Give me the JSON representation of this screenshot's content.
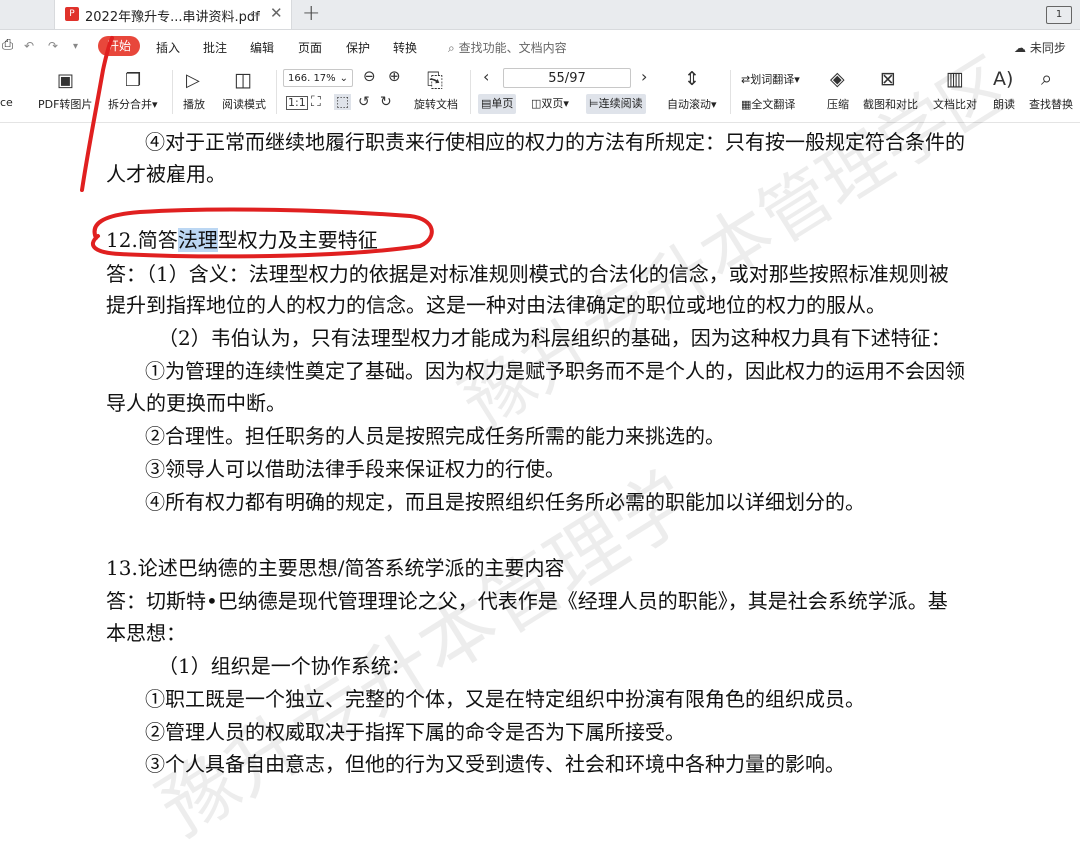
{
  "tab": {
    "title": "2022年豫升专...串讲资料.pdf",
    "pdf_badge": "P",
    "page_indicator": "1"
  },
  "menu": {
    "items": [
      "开始",
      "插入",
      "批注",
      "编辑",
      "页面",
      "保护",
      "转换"
    ],
    "search_placeholder": "查找功能、文档内容",
    "sync_label": "未同步"
  },
  "toolbar": {
    "left_cut": "ce",
    "pdf_to_image": "PDF转图片",
    "split_merge": "拆分合并",
    "play": "播放",
    "read_mode": "阅读模式",
    "zoom_value": "166. 17%",
    "rotate_doc": "旋转文档",
    "page_value": "55/97",
    "single_page": "单页",
    "double_page": "双页",
    "continuous": "连续阅读",
    "auto_scroll": "自动滚动",
    "word_translate": "划词翻译",
    "full_translate": "全文翻译",
    "compress": "压缩",
    "screenshot_compare": "截图和对比",
    "doc_compare": "文档比对",
    "read_aloud": "朗读",
    "find_replace": "查找替换"
  },
  "document": {
    "line_01": "④对于正常而继续地履行职责来行使相应的权力的方法有所规定：只有按一般规定符合条件的",
    "line_02": "人才被雇用。",
    "heading_12_a": "12.简答",
    "heading_12_hl": "法理",
    "heading_12_b": "型权力及主要特征",
    "line_03": "答：（1）含义：法理型权力的依据是对标准规则模式的合法化的信念，或对那些按照标准规则被",
    "line_04": "提升到指挥地位的人的权力的信念。这是一种对由法律确定的职位或地位的权力的服从。",
    "line_05": "（2）韦伯认为，只有法理型权力才能成为科层组织的基础，因为这种权力具有下述特征：",
    "line_06": "①为管理的连续性奠定了基础。因为权力是赋予职务而不是个人的，因此权力的运用不会因领",
    "line_07": "导人的更换而中断。",
    "line_08": "②合理性。担任职务的人员是按照完成任务所需的能力来挑选的。",
    "line_09": "③领导人可以借助法律手段来保证权力的行使。",
    "line_10": "④所有权力都有明确的规定，而且是按照组织任务所必需的职能加以详细划分的。",
    "heading_13": "13.论述巴纳德的主要思想/简答系统学派的主要内容",
    "line_11": "答：切斯特•巴纳德是现代管理理论之父，代表作是《经理人员的职能》，其是社会系统学派。基",
    "line_12": "本思想：",
    "line_13": "（1）组织是一个协作系统：",
    "line_14": "①职工既是一个独立、完整的个体，又是在特定组织中扮演有限角色的组织成员。",
    "line_15": "②管理人员的权威取决于指挥下属的命令是否为下属所接受。",
    "line_16": "③个人具备自由意志，但他的行为又受到遗传、社会和环境中各种力量的影响。"
  },
  "watermark": {
    "text_a": "豫升专升本管理学",
    "text_b": "豫升专升本管理学区"
  },
  "colors": {
    "accent_red": "#e8473b",
    "annotation_red": "#e02020",
    "highlight": "#bcd7f3"
  }
}
